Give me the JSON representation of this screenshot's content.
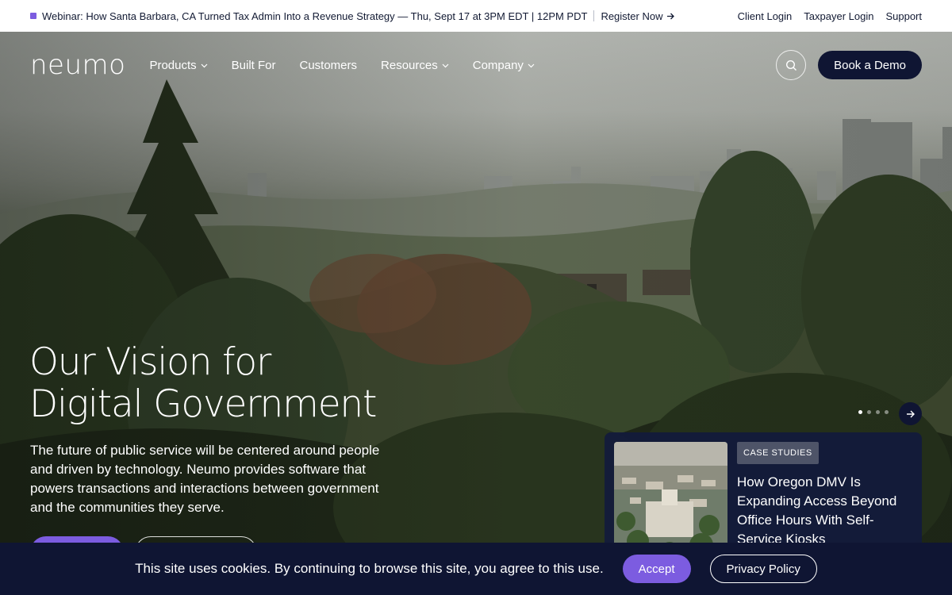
{
  "announcement": {
    "message": "Webinar: How Santa Barbara, CA Turned Tax Admin Into a Revenue Strategy — Thu, Sept 17 at 3PM EDT | 12PM PDT",
    "link_label": "Register Now",
    "icon": "arrow-right-icon"
  },
  "utility_nav": [
    "Client Login",
    "Taxpayer Login",
    "Support"
  ],
  "nav": {
    "logo": "neumo",
    "items": [
      {
        "label": "Products",
        "has_dropdown": true
      },
      {
        "label": "Built For",
        "has_dropdown": false
      },
      {
        "label": "Customers",
        "has_dropdown": false
      },
      {
        "label": "Resources",
        "has_dropdown": true
      },
      {
        "label": "Company",
        "has_dropdown": true
      }
    ],
    "search_icon": "search-icon",
    "demo_label": "Book a Demo"
  },
  "hero": {
    "headline_line1": "Our Vision for",
    "headline_line2": "Digital Government",
    "subtext": "The future of public service will be centered around people and driven by technology. Neumo provides software that powers transactions and interactions between government and the communities they serve."
  },
  "carousel": {
    "slide_count": 4,
    "active_index": 0,
    "next_icon": "arrow-right-icon"
  },
  "case_study_card": {
    "tag": "CASE STUDIES",
    "title": "How Oregon DMV Is Expanding Access Beyond Office Hours With Self-Service Kiosks"
  },
  "cookie_banner": {
    "text": "This site uses cookies. By continuing to browse this site, you agree to this use.",
    "accept_label": "Accept",
    "privacy_label": "Privacy Policy"
  },
  "colors": {
    "accent": "#7c5ce0",
    "navy": "#0f1533",
    "card_bg": "#121a3c"
  }
}
